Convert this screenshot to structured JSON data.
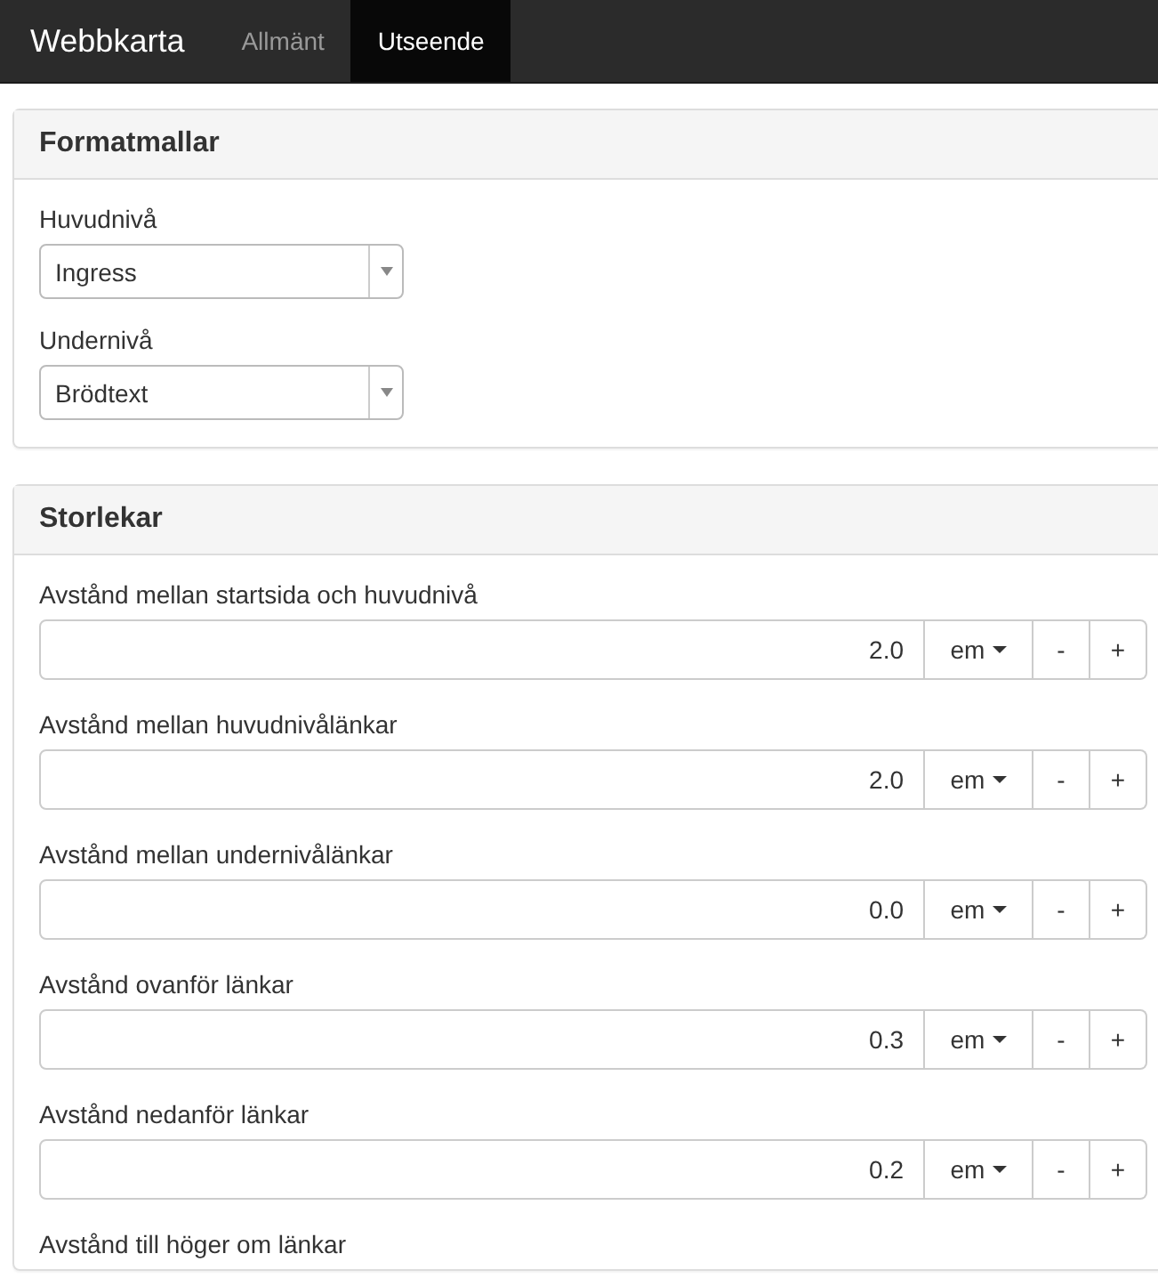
{
  "navbar": {
    "brand": "Webbkarta",
    "tabs": [
      {
        "label": "Allmänt",
        "selected": false
      },
      {
        "label": "Utseende",
        "selected": true
      }
    ]
  },
  "panels": [
    {
      "title": "Formatmallar",
      "fields": [
        {
          "kind": "select",
          "label": "Huvudnivå",
          "value": "Ingress"
        },
        {
          "kind": "select",
          "label": "Undernivå",
          "value": "Brödtext"
        }
      ]
    },
    {
      "title": "Storlekar",
      "fields": [
        {
          "kind": "number",
          "label": "Avstånd mellan startsida och huvudnivå",
          "value": "2.0",
          "unit": "em",
          "minus": "-",
          "plus": "+"
        },
        {
          "kind": "number",
          "label": "Avstånd mellan huvudnivålänkar",
          "value": "2.0",
          "unit": "em",
          "minus": "-",
          "plus": "+"
        },
        {
          "kind": "number",
          "label": "Avstånd mellan undernivålänkar",
          "value": "0.0",
          "unit": "em",
          "minus": "-",
          "plus": "+"
        },
        {
          "kind": "number",
          "label": "Avstånd ovanför länkar",
          "value": "0.3",
          "unit": "em",
          "minus": "-",
          "plus": "+"
        },
        {
          "kind": "number",
          "label": "Avstånd nedanför länkar",
          "value": "0.2",
          "unit": "em",
          "minus": "-",
          "plus": "+"
        },
        {
          "kind": "label",
          "label": "Avstånd till höger om länkar"
        }
      ]
    }
  ]
}
